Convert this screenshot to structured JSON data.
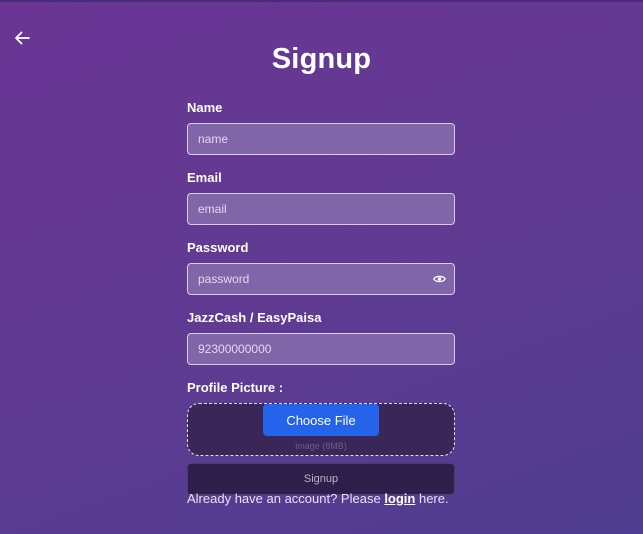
{
  "page": {
    "title": "Signup"
  },
  "form": {
    "name": {
      "label": "Name",
      "placeholder": "name",
      "value": ""
    },
    "email": {
      "label": "Email",
      "placeholder": "email",
      "value": ""
    },
    "password": {
      "label": "Password",
      "placeholder": "password",
      "value": ""
    },
    "wallet": {
      "label": "JazzCash / EasyPaisa",
      "placeholder": "92300000000",
      "value": ""
    },
    "profile_picture": {
      "label": "Profile Picture :",
      "choose_label": "Choose File",
      "hint": "image (8MB)"
    },
    "submit_label": "Signup"
  },
  "footer": {
    "text_before": "Already have an account? Please ",
    "link_label": "login",
    "text_after": " here."
  },
  "icons": {
    "back": "arrow-left-icon",
    "password_toggle": "eye-icon"
  },
  "colors": {
    "accent": "#2563eb",
    "background_start": "#6a3594",
    "background_end": "#4e3d90"
  }
}
